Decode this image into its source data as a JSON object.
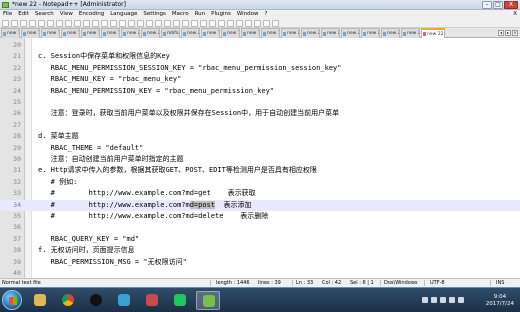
{
  "window": {
    "title": "*new 22 - Notepad++ [Administrator]",
    "buttons": [
      "–",
      "□",
      "X"
    ]
  },
  "menu": [
    "File",
    "Edit",
    "Search",
    "View",
    "Encoding",
    "Language",
    "Settings",
    "Macro",
    "Run",
    "Plugins",
    "Window",
    "?"
  ],
  "menu_right": "X",
  "tabs": [
    {
      "label": "new 14"
    },
    {
      "label": "new 15"
    },
    {
      "label": "new 16"
    },
    {
      "label": "new 17"
    },
    {
      "label": "new 18"
    },
    {
      "label": "new 19"
    },
    {
      "label": "new 20"
    },
    {
      "label": "new 21"
    },
    {
      "label": "mbfa89"
    },
    {
      "label": "new 22"
    },
    {
      "label": "new 16"
    },
    {
      "label": "new 17"
    },
    {
      "label": "new 18"
    },
    {
      "label": "new 19"
    },
    {
      "label": "new 20"
    },
    {
      "label": "new 21"
    },
    {
      "label": "new 22"
    },
    {
      "label": "new 23"
    },
    {
      "label": "new 24"
    },
    {
      "label": "new 25"
    },
    {
      "label": "new 26"
    },
    {
      "label": "new 22",
      "active": true
    }
  ],
  "editor": {
    "lines": [
      {
        "n": "20",
        "text": ""
      },
      {
        "n": "21",
        "text": "c. Session中保存菜单和权限信息的Key"
      },
      {
        "n": "22",
        "text": "   RBAC_MENU_PERMISSION_SESSION_KEY = \"rbac_menu_permission_session_key\""
      },
      {
        "n": "23",
        "text": "   RBAC_MENU_KEY = \"rbac_menu_key\""
      },
      {
        "n": "24",
        "text": "   RBAC_MENU_PERMISSION_KEY = \"rbac_menu_permission_key\""
      },
      {
        "n": "25",
        "text": ""
      },
      {
        "n": "26",
        "text": "   注意：登录时，获取当前用户菜单以及权限并保存在Session中，用于自动创建当前用户菜单"
      },
      {
        "n": "27",
        "text": ""
      },
      {
        "n": "28",
        "text": "d. 菜单主题"
      },
      {
        "n": "29",
        "text": "   RBAC_THEME = \"default\""
      },
      {
        "n": "30",
        "text": "   注意：自动创建当前用户菜单时指定的主题"
      },
      {
        "n": "31",
        "text": "e. Http请求中传入的参数，根据其获取GET、POST、EDIT等检测用户是否具有相应权限"
      },
      {
        "n": "32",
        "text": "   # 例如:"
      },
      {
        "n": "33",
        "text": "   #        http://www.example.com?md=get    表示获取"
      },
      {
        "n": "34",
        "pre": "   #        http://www.example.com?m",
        "sel": "d=post",
        "post": "  表示添加"
      },
      {
        "n": "35",
        "text": "   #        http://www.example.com?md=delete    表示删除"
      },
      {
        "n": "36",
        "text": ""
      },
      {
        "n": "37",
        "text": "   RBAC_QUERY_KEY = \"md\""
      },
      {
        "n": "38",
        "text": "f. 无权访问时，页面提示信息"
      },
      {
        "n": "39",
        "text": "   RBAC_PERMISSION_MSG = \"无权限访问\""
      },
      {
        "n": "40",
        "text": ""
      }
    ]
  },
  "status": {
    "type": "Normal text file",
    "length": "length : 1446",
    "lines": "lines : 39",
    "ln": "Ln : 33",
    "col": "Col : 42",
    "sel": "Sel : 6 | 1",
    "eol": "Dos\\Windows",
    "enc": "UTF-8",
    "ins": "INS"
  },
  "taskbar": {
    "time": "9:04",
    "date": "2017/7/24"
  }
}
